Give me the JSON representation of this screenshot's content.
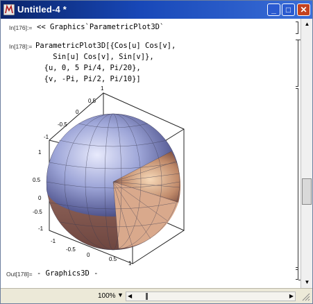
{
  "window": {
    "title": "Untitled-4 *"
  },
  "cells": [
    {
      "label": "In[176]:=",
      "lines": [
        "<< Graphics`ParametricPlot3D`"
      ]
    },
    {
      "label": "In[178]:=",
      "lines": [
        "ParametricPlot3D[{Cos[u] Cos[v],",
        "    Sin[u] Cos[v], Sin[v]},",
        "  {u, 0, 5 Pi/4, Pi/20},",
        "  {v, -Pi, Pi/2, Pi/10}]"
      ]
    },
    {
      "label": "Out[178]=",
      "lines": [
        "- Graphics3D -"
      ]
    }
  ],
  "plot": {
    "ticks_top": [
      "1",
      "0.5",
      "0",
      "-0.5",
      "-1"
    ],
    "ticks_left": [
      "1",
      "0.5",
      "0",
      "-0.5",
      "-1"
    ],
    "ticks_bottom": [
      "-1",
      "-0.5",
      "0",
      "0.5",
      "1"
    ]
  },
  "status": {
    "zoom": "100%"
  },
  "icons": {
    "titlebar": "mathematica-icon",
    "min": "minimize-icon",
    "max": "maximize-icon",
    "close": "close-icon"
  }
}
